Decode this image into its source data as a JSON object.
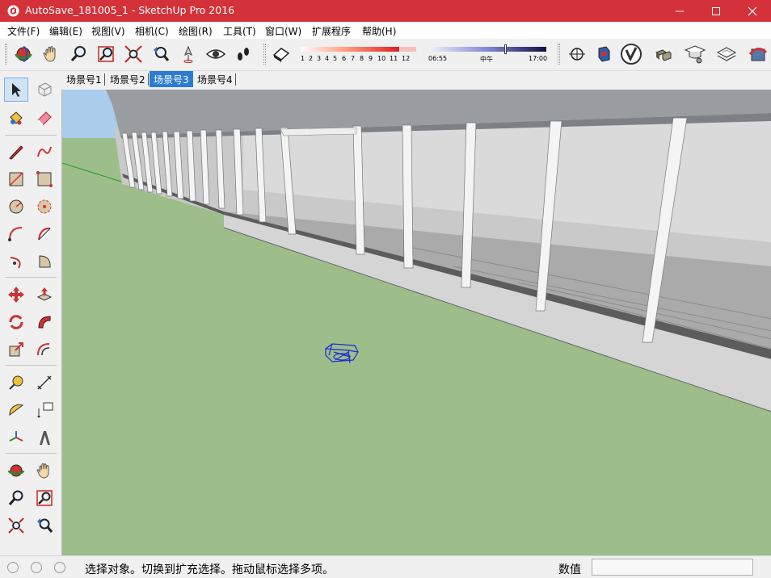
{
  "window": {
    "title": "AutoSave_181005_1 - SketchUp Pro 2016",
    "minimize_icon": "minimize-icon",
    "maximize_icon": "maximize-icon",
    "close_icon": "close-icon"
  },
  "menu": [
    {
      "label": "文件(F)"
    },
    {
      "label": "编辑(E)"
    },
    {
      "label": "视图(V)"
    },
    {
      "label": "相机(C)"
    },
    {
      "label": "绘图(R)"
    },
    {
      "label": "工具(T)"
    },
    {
      "label": "窗口(W)"
    },
    {
      "label": "扩展程序"
    },
    {
      "label": "帮助(H)"
    }
  ],
  "toolbar": {
    "shadow_months": [
      "1",
      "2",
      "3",
      "4",
      "5",
      "6",
      "7",
      "8",
      "9",
      "10",
      "11",
      "12"
    ],
    "time_start": "06:55",
    "time_mid": "中午",
    "time_end": "17:00"
  },
  "scenes": {
    "tabs": [
      {
        "label": "场景号1"
      },
      {
        "label": "场景号2"
      },
      {
        "label": "场景号3",
        "active": true
      },
      {
        "label": "场景号4"
      }
    ]
  },
  "colors": {
    "titlebar": "#d4323a",
    "ground": "#9dbe8a",
    "sky": "#a9cdea",
    "selection": "#1d2bd6"
  },
  "statusbar": {
    "message": "选择对象。切换到扩充选择。拖动鼠标选择多项。",
    "measure_label": "数值",
    "measure_value": ""
  }
}
